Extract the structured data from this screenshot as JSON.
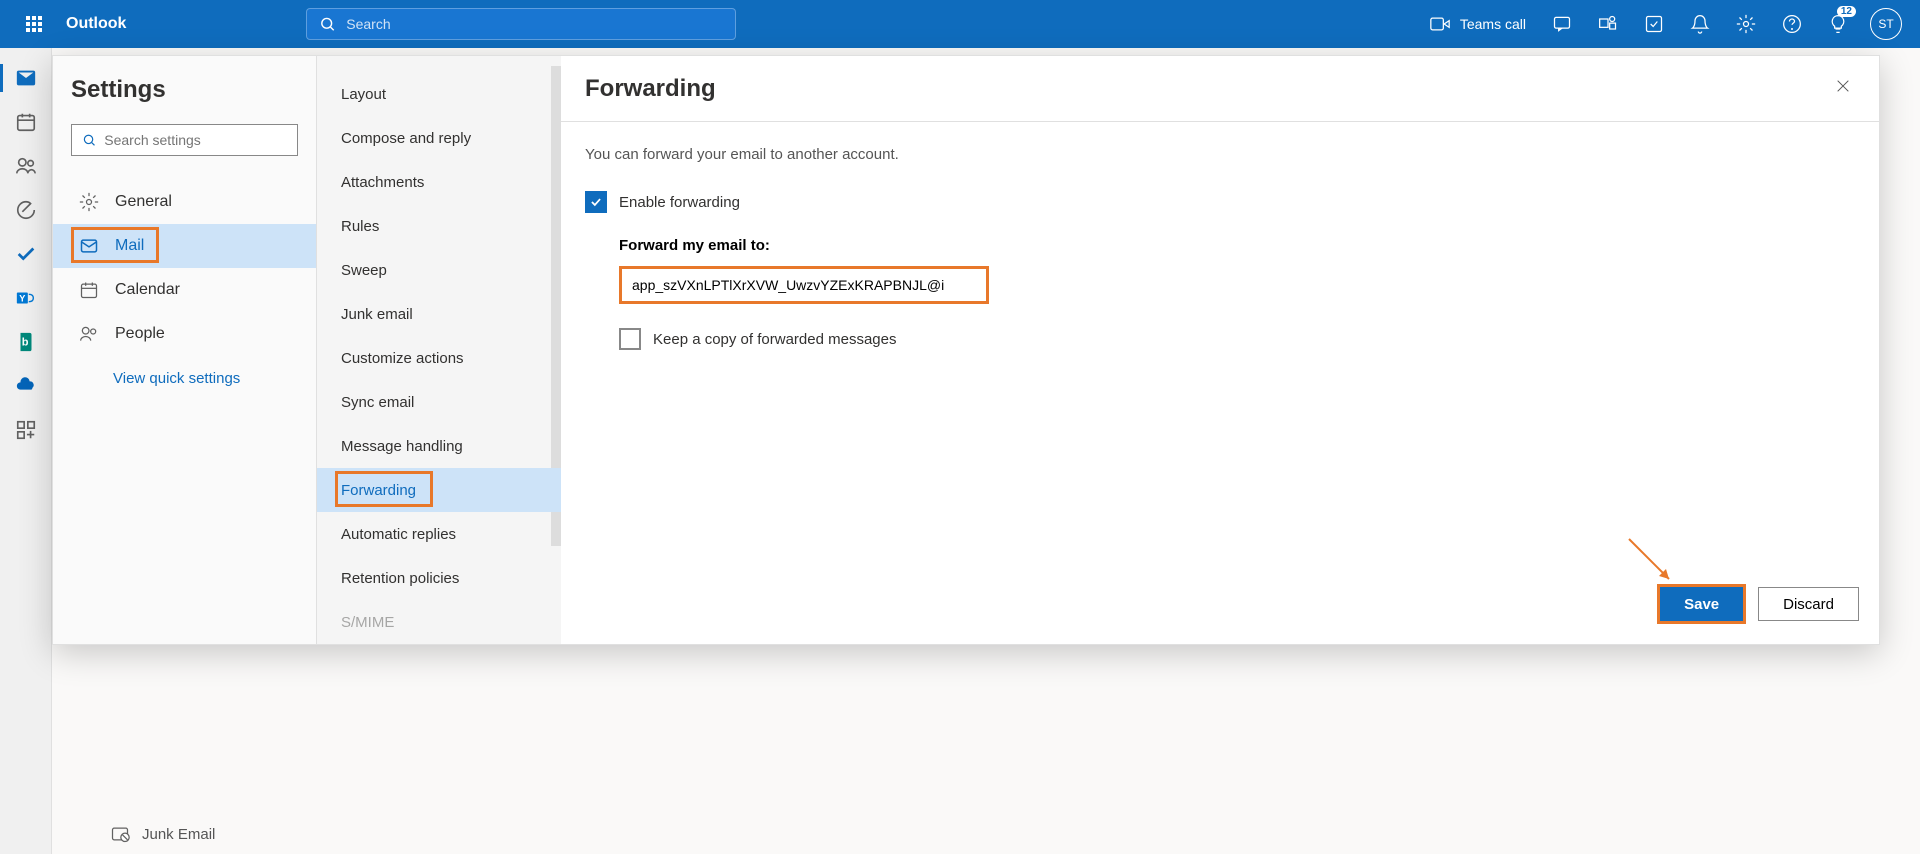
{
  "header": {
    "app_name": "Outlook",
    "search_placeholder": "Search",
    "teams_call": "Teams call",
    "badge_count": "12",
    "avatar_initials": "ST"
  },
  "settings": {
    "title": "Settings",
    "search_placeholder": "Search settings",
    "nav": [
      {
        "label": "General",
        "icon": "gear"
      },
      {
        "label": "Mail",
        "icon": "mail",
        "active": true
      },
      {
        "label": "Calendar",
        "icon": "calendar"
      },
      {
        "label": "People",
        "icon": "people"
      }
    ],
    "view_quick": "View quick settings"
  },
  "middle_nav": [
    "Layout",
    "Compose and reply",
    "Attachments",
    "Rules",
    "Sweep",
    "Junk email",
    "Customize actions",
    "Sync email",
    "Message handling",
    "Forwarding",
    "Automatic replies",
    "Retention policies",
    "S/MIME"
  ],
  "forwarding": {
    "title": "Forwarding",
    "description": "You can forward your email to another account.",
    "enable_label": "Enable forwarding",
    "forward_to_label": "Forward my email to:",
    "email_value": "app_szVXnLPTlXrXVW_UwzvYZExKRAPBNJL@i",
    "keep_copy_label": "Keep a copy of forwarded messages",
    "save_label": "Save",
    "discard_label": "Discard"
  },
  "background": {
    "junk_email": "Junk Email"
  }
}
